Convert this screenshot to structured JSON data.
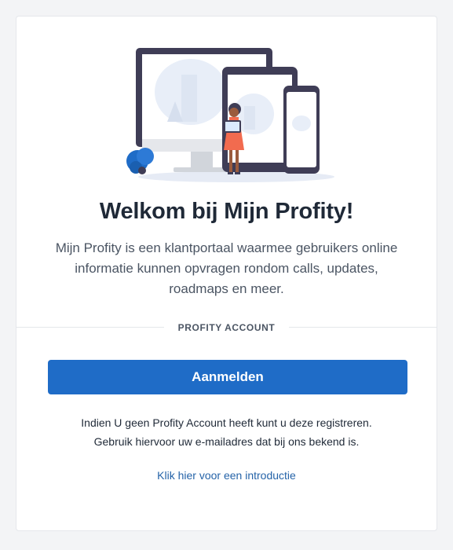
{
  "welcome": {
    "title": "Welkom bij Mijn Profity!",
    "description": "Mijn Profity is een klantportaal waarmee gebruikers online informatie kunnen opvragen rondom calls, updates, roadmaps en meer."
  },
  "account_section": {
    "label": "PROFITY ACCOUNT",
    "login_button": "Aanmelden",
    "info_line_1": "Indien U geen Profity Account heeft kunt u deze registreren.",
    "info_line_2": "Gebruik hiervoor uw e-mailadres dat bij ons bekend is.",
    "intro_link": "Klik hier voor een introductie"
  },
  "colors": {
    "accent": "#1f6cc7",
    "link": "#2563a8",
    "device_frame": "#3f3d56",
    "figure_dress": "#f26b4f"
  },
  "illustration": {
    "icon": "devices-illustration"
  }
}
